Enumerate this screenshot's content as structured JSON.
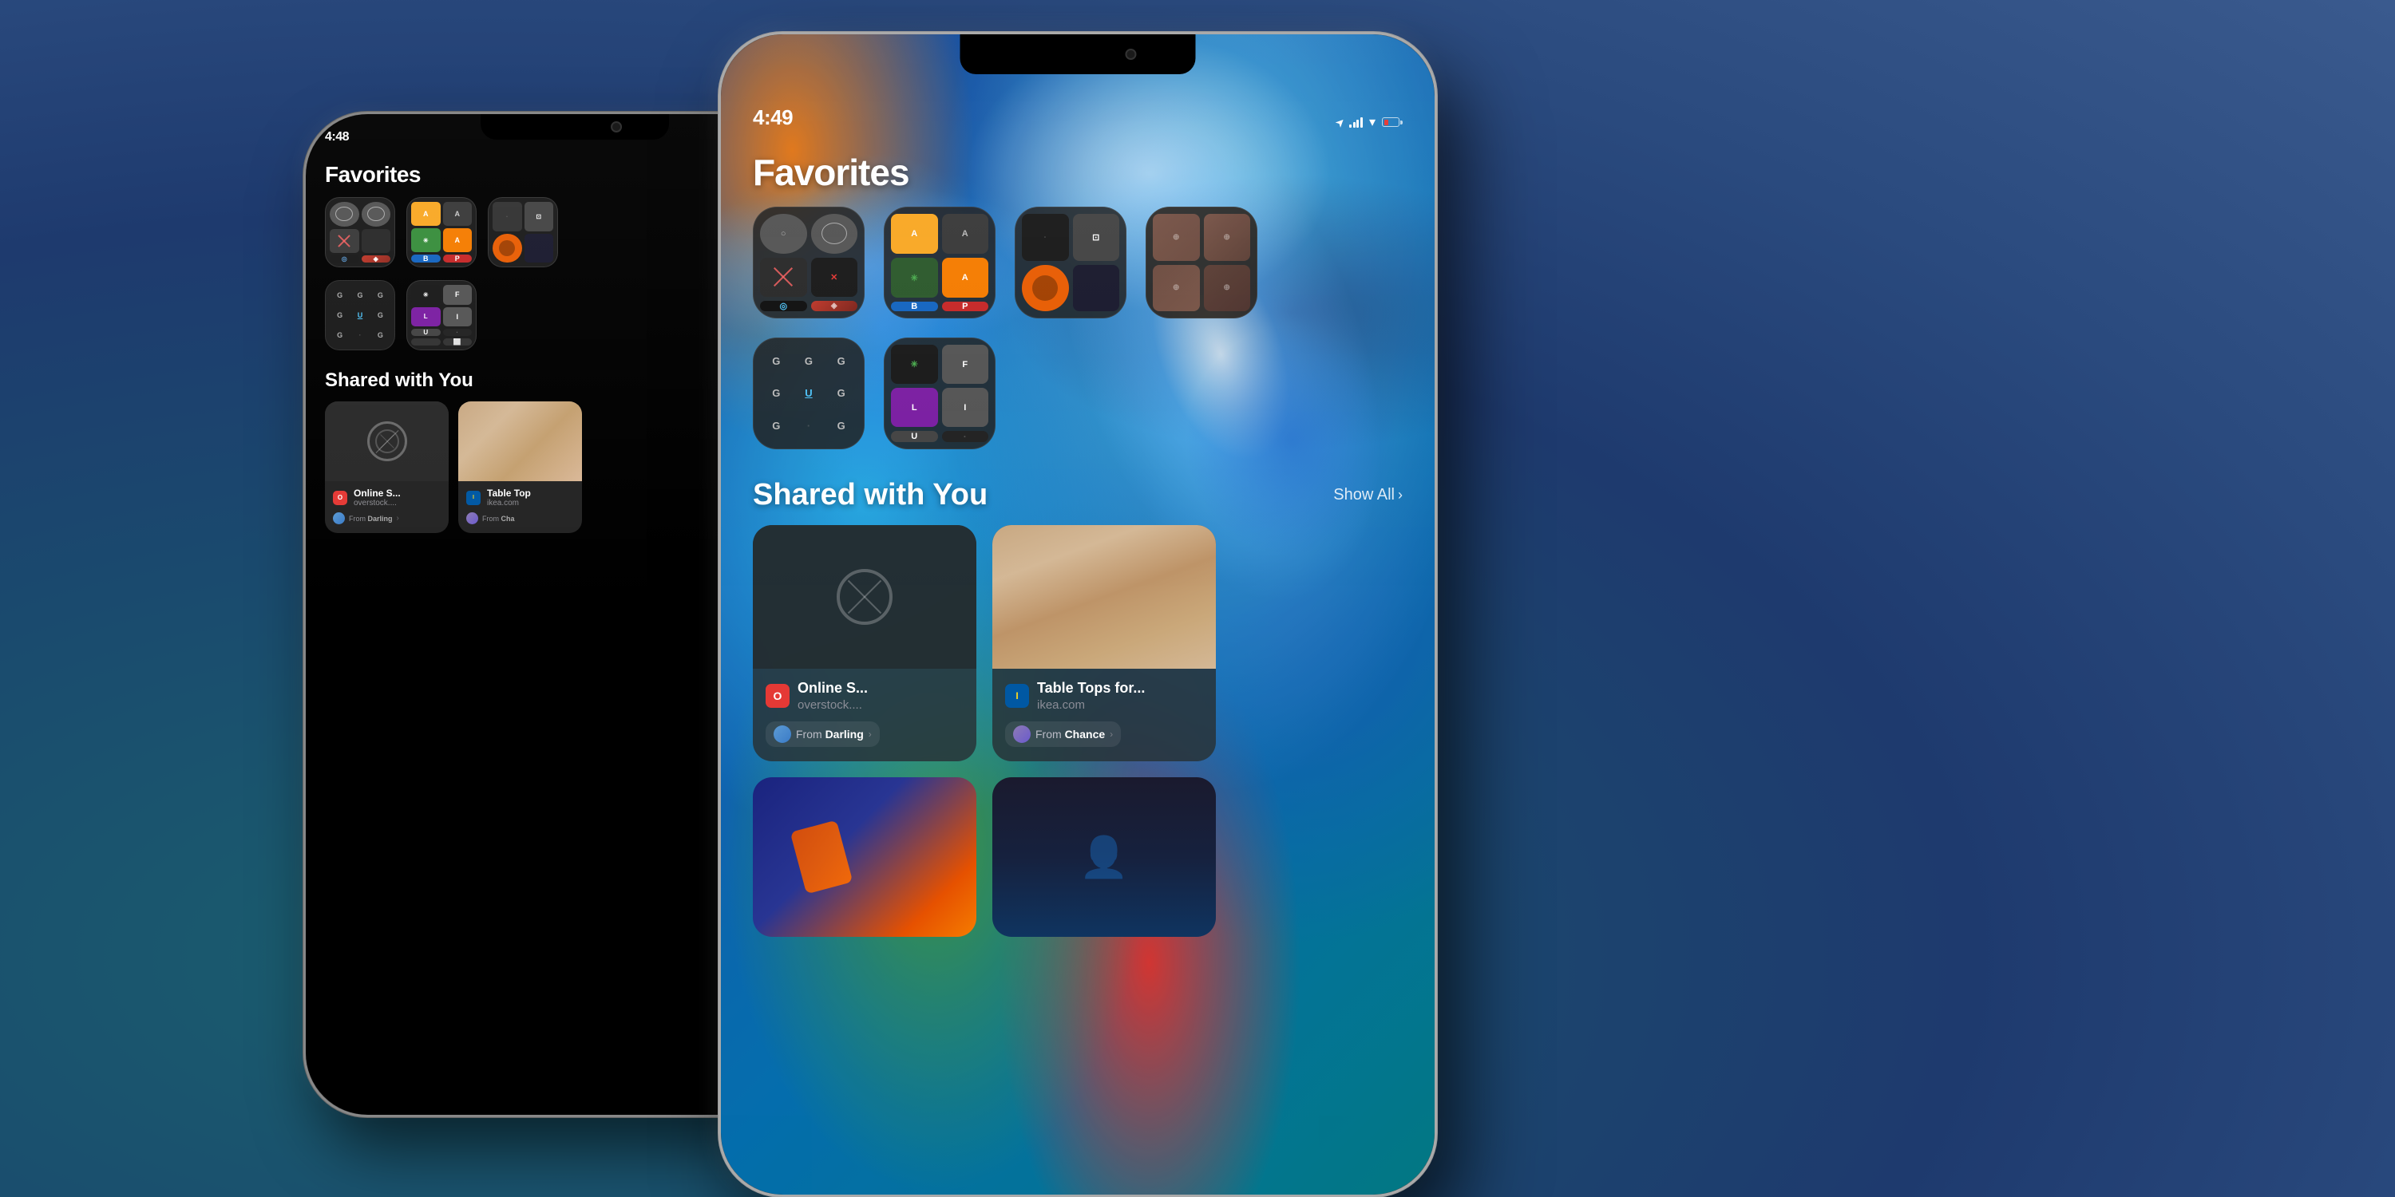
{
  "background": {
    "gradient": "blue-teal"
  },
  "back_phone": {
    "status": {
      "time": "4:48",
      "location": true,
      "signal": "full",
      "wifi": true,
      "battery": "low"
    },
    "favorites": {
      "title": "Favorites",
      "row1": [
        {
          "type": "folder4",
          "id": "f1"
        },
        {
          "type": "folder4",
          "id": "f2"
        },
        {
          "type": "folder4",
          "id": "f3"
        }
      ],
      "row2": [
        {
          "type": "letter-grid",
          "id": "g1"
        },
        {
          "type": "folder-fi",
          "id": "g2"
        }
      ]
    },
    "shared": {
      "title": "Shared with You",
      "cards": [
        {
          "title": "Online S...",
          "domain": "overstock....",
          "from_name": "Darling",
          "favicon_type": "overstock"
        },
        {
          "title": "Table Top",
          "domain": "ikea.com",
          "from_name": "Cha",
          "favicon_type": "ikea",
          "thumb_type": "wood"
        }
      ]
    }
  },
  "front_phone": {
    "status": {
      "time": "4:49",
      "location": true,
      "signal": "full",
      "wifi": true,
      "battery": "low"
    },
    "favorites": {
      "title": "Favorites",
      "row1": [
        {
          "type": "folder4-dark",
          "id": "ff1"
        },
        {
          "type": "folder4-green",
          "id": "ff2"
        },
        {
          "type": "folder4-orange",
          "id": "ff3"
        },
        {
          "type": "folder4-brown",
          "id": "ff4"
        }
      ],
      "row2": [
        {
          "type": "letter-grid-g",
          "id": "fg1"
        },
        {
          "type": "folder-fi2",
          "id": "fg2"
        }
      ]
    },
    "shared": {
      "title": "Shared with You",
      "show_all": "Show All",
      "cards": [
        {
          "title": "Online S...",
          "domain": "overstock....",
          "from_label": "From Darling",
          "from_name": "Darling",
          "favicon_type": "overstock",
          "thumb_type": "safari"
        },
        {
          "title": "Table Tops for...",
          "domain": "ikea.com",
          "from_label": "From Chance",
          "from_name": "Chance",
          "favicon_type": "ikea",
          "thumb_type": "wood"
        }
      ],
      "bottom_cards": [
        {
          "type": "kite",
          "id": "bc1"
        },
        {
          "type": "mannequin",
          "id": "bc2"
        }
      ]
    }
  }
}
